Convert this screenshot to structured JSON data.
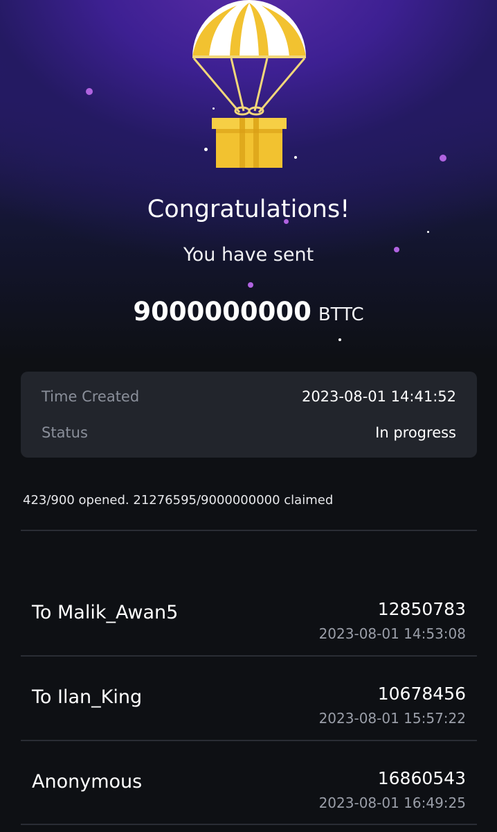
{
  "hero": {
    "title": "Congratulations!",
    "subtitle": "You have sent",
    "amount": "9000000000",
    "unit": "BTTC",
    "icon": "parachute-gift-icon"
  },
  "details": {
    "time_label": "Time Created",
    "time_value": "2023-08-01 14:41:52",
    "status_label": "Status",
    "status_value": "In progress"
  },
  "summary": "423/900 opened. 21276595/9000000000 claimed",
  "claims": [
    {
      "name": "To Malik_Awan5",
      "amount": "12850783",
      "time": "2023-08-01 14:53:08"
    },
    {
      "name": "To Ilan_King",
      "amount": "10678456",
      "time": "2023-08-01 15:57:22"
    },
    {
      "name": "Anonymous",
      "amount": "16860543",
      "time": "2023-08-01 16:49:25"
    }
  ],
  "colors": {
    "background": "#0e1014",
    "hero_purple": "#3d2092",
    "card": "#22252c",
    "gold": "#f2c230",
    "muted_text": "#8a8f9a"
  }
}
